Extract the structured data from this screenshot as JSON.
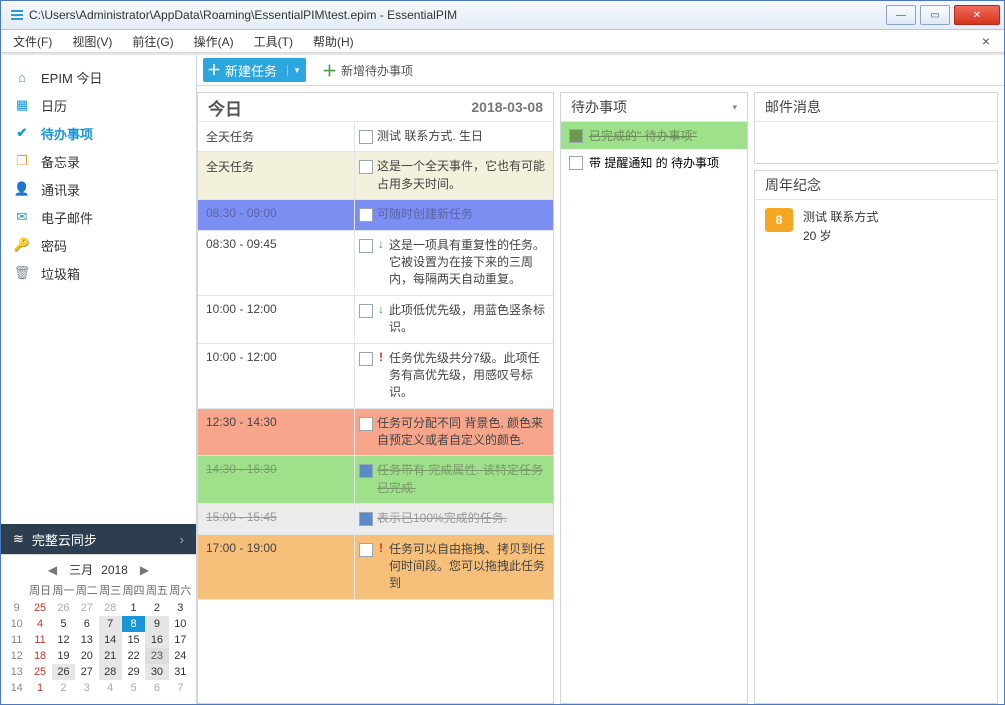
{
  "window": {
    "title": "C:\\Users\\Administrator\\AppData\\Roaming\\EssentialPIM\\test.epim - EssentialPIM"
  },
  "menu": {
    "items": [
      "文件(F)",
      "视图(V)",
      "前往(G)",
      "操作(A)",
      "工具(T)",
      "帮助(H)"
    ]
  },
  "sidebar": {
    "items": [
      {
        "label": "EPIM 今日"
      },
      {
        "label": "日历"
      },
      {
        "label": "待办事项"
      },
      {
        "label": "备忘录"
      },
      {
        "label": "通讯录"
      },
      {
        "label": "电子邮件"
      },
      {
        "label": "密码"
      },
      {
        "label": "垃圾箱"
      }
    ]
  },
  "sync": {
    "label": "完整云同步"
  },
  "minical": {
    "month": "三月",
    "year": "2018",
    "dow": [
      "周日",
      "周一",
      "周二",
      "周三",
      "周四",
      "周五",
      "周六"
    ],
    "weeks": [
      {
        "wk": "9",
        "days": [
          {
            "d": "25",
            "c": "sun dim"
          },
          {
            "d": "26",
            "c": "dim"
          },
          {
            "d": "27",
            "c": "dim"
          },
          {
            "d": "28",
            "c": "dim"
          },
          {
            "d": "1"
          },
          {
            "d": "2"
          },
          {
            "d": "3"
          }
        ]
      },
      {
        "wk": "10",
        "days": [
          {
            "d": "4",
            "c": "sun"
          },
          {
            "d": "5"
          },
          {
            "d": "6"
          },
          {
            "d": "7",
            "c": "hl"
          },
          {
            "d": "8",
            "c": "today"
          },
          {
            "d": "9",
            "c": "hl"
          },
          {
            "d": "10"
          }
        ]
      },
      {
        "wk": "11",
        "days": [
          {
            "d": "11",
            "c": "sun"
          },
          {
            "d": "12"
          },
          {
            "d": "13"
          },
          {
            "d": "14",
            "c": "hl"
          },
          {
            "d": "15"
          },
          {
            "d": "16",
            "c": "hl"
          },
          {
            "d": "17"
          }
        ]
      },
      {
        "wk": "12",
        "days": [
          {
            "d": "18",
            "c": "sun"
          },
          {
            "d": "19"
          },
          {
            "d": "20"
          },
          {
            "d": "21",
            "c": "hl"
          },
          {
            "d": "22"
          },
          {
            "d": "23",
            "c": "sel"
          },
          {
            "d": "24"
          }
        ]
      },
      {
        "wk": "13",
        "days": [
          {
            "d": "25",
            "c": "sun"
          },
          {
            "d": "26",
            "c": "hl"
          },
          {
            "d": "27"
          },
          {
            "d": "28",
            "c": "hl"
          },
          {
            "d": "29"
          },
          {
            "d": "30",
            "c": "hl"
          },
          {
            "d": "31"
          }
        ]
      },
      {
        "wk": "14",
        "days": [
          {
            "d": "1",
            "c": "sun dim"
          },
          {
            "d": "2",
            "c": "dim"
          },
          {
            "d": "3",
            "c": "dim"
          },
          {
            "d": "4",
            "c": "dim"
          },
          {
            "d": "5",
            "c": "dim"
          },
          {
            "d": "6",
            "c": "dim"
          },
          {
            "d": "7",
            "c": "dim"
          }
        ]
      }
    ]
  },
  "toolbar": {
    "new_task": "新建任务",
    "new_todo": "新增待办事项"
  },
  "today": {
    "heading": "今日",
    "date": "2018-03-08",
    "rows": [
      {
        "time": "全天任务",
        "text": "测试 联系方式. 生日",
        "bg": ""
      },
      {
        "time": "全天任务",
        "text": "这是一个全天事件，它也有可能占用多天时间。",
        "bg": "bg-cream"
      },
      {
        "time": "08:30 - 09:00",
        "text": "可随时创建新任务",
        "bg": "bg-blue"
      },
      {
        "time": "08:30 - 09:45",
        "ind": "↓",
        "text": "这是一项具有重复性的任务。它被设置为在接下来的三周内，每隔两天自动重复。",
        "bg": ""
      },
      {
        "time": "10:00 - 12:00",
        "ind": "↓",
        "text": "此项低优先级，用蓝色竖条标识。",
        "bg": ""
      },
      {
        "time": "10:00 - 12:00",
        "ind": "!",
        "indcls": "red",
        "text": "任务优先级共分7级。此项任务有高优先级，用感叹号标识。",
        "bg": ""
      },
      {
        "time": "12:30 - 14:30",
        "text": "任务可分配不同 背景色, 颜色来自预定义或者自定义的颜色.",
        "bg": "bg-red"
      },
      {
        "time": "14:30 - 16:30",
        "chk": true,
        "text": "任务带有 完成属性. 该特定任务已完成.",
        "bg": "bg-green"
      },
      {
        "time": "15:00 - 15:45",
        "chk": true,
        "text": "表示已100%完成的任务.",
        "bg": "bg-lgrey"
      },
      {
        "time": "17:00 - 19:00",
        "ind": "!",
        "indcls": "red",
        "text": "任务可以自由拖拽、拷贝到任何时间段。您可以拖拽此任务到",
        "bg": "bg-orange"
      }
    ]
  },
  "todo": {
    "heading": "待办事项",
    "items": [
      {
        "text": "已完成的\" 待办事项\"",
        "done": true
      },
      {
        "text": "带 提醒通知 的 待办事项",
        "done": false
      }
    ]
  },
  "mail": {
    "heading": "邮件消息"
  },
  "anniv": {
    "heading": "周年纪念",
    "badge": "8",
    "name": "测试 联系方式",
    "age": "20 岁"
  }
}
